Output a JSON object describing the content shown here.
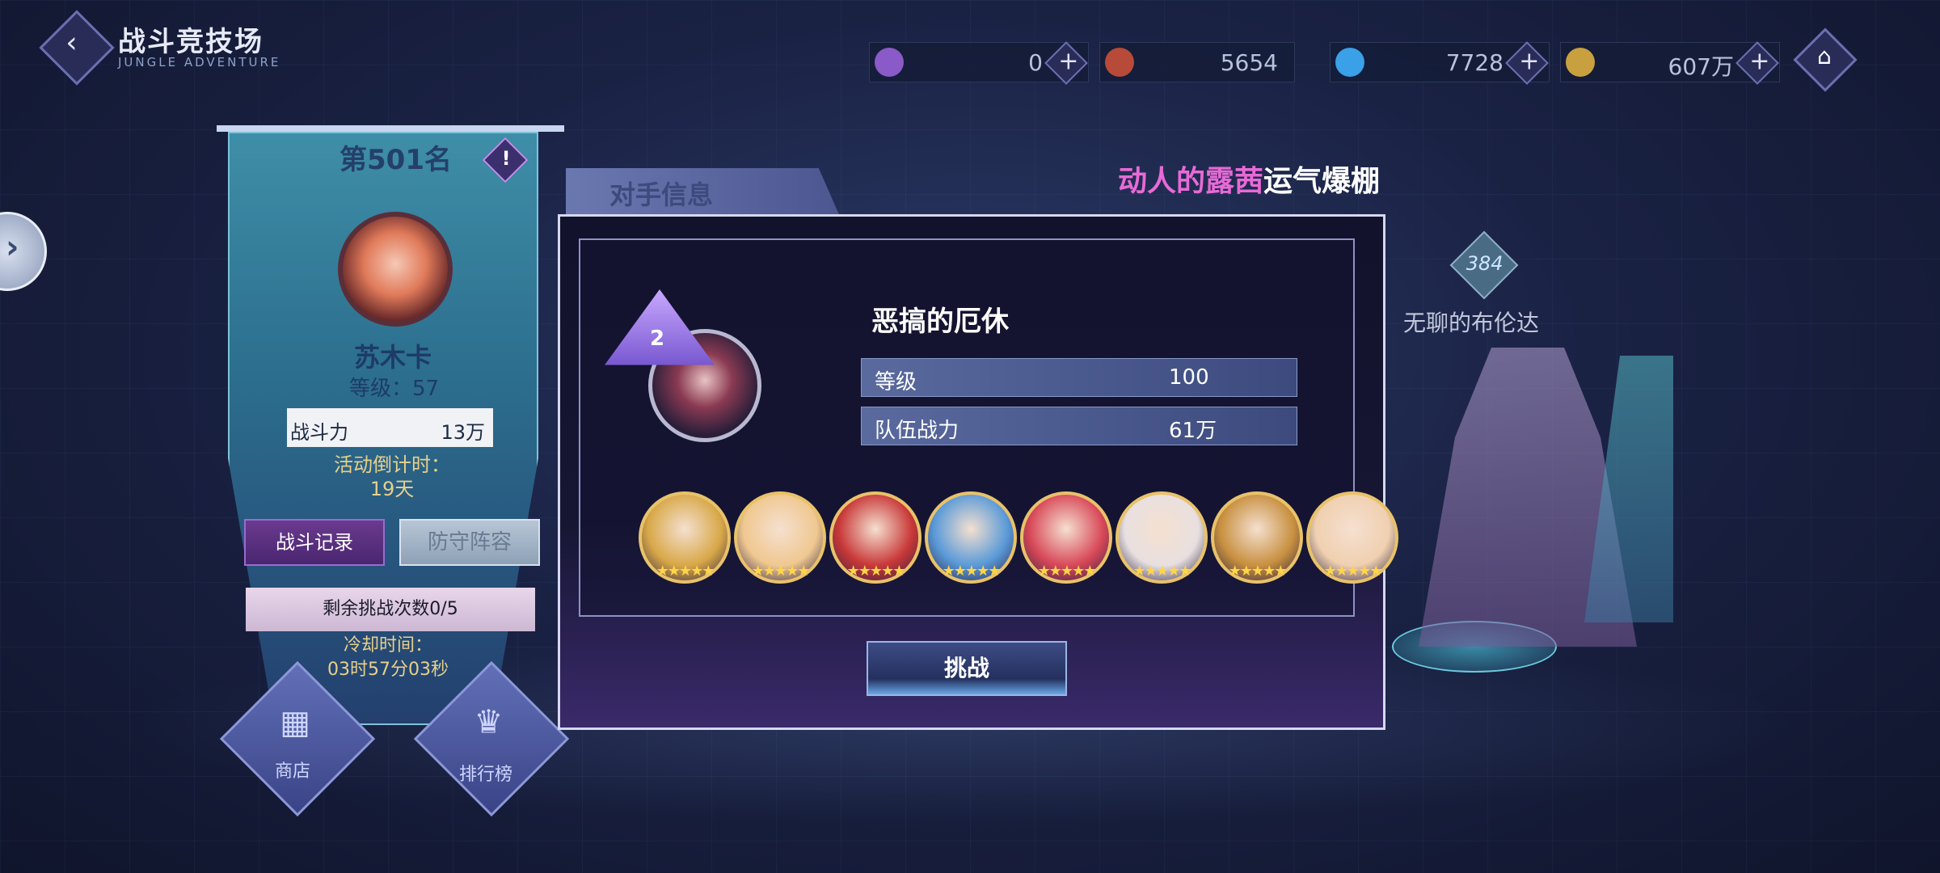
{
  "header": {
    "title": "战斗竞技场",
    "subtitle": "JUNGLE ADVENTURE",
    "back_glyph": "‹",
    "home_glyph": "⌂"
  },
  "resources": [
    {
      "icon": "purple-gem-icon",
      "value": "0",
      "color": "#8a5ac8"
    },
    {
      "icon": "medal-coin-icon",
      "value": "5654",
      "color": "#b84a3a"
    },
    {
      "icon": "blue-diamond-icon",
      "value": "7728",
      "color": "#3aa0e8"
    },
    {
      "icon": "gold-coin-icon",
      "value": "607万",
      "color": "#c8a040"
    }
  ],
  "player": {
    "rank": "第501名",
    "info_glyph": "!",
    "name": "苏木卡",
    "level": "等级：57",
    "power_label": "战斗力",
    "power_value": "13万",
    "countdown_label": "活动倒计时：",
    "countdown_value": "19天",
    "record_button": "战斗记录",
    "defense_button": "防守阵容",
    "remaining": "剩余挑战次数0/5",
    "cooldown_label": "冷却时间：",
    "cooldown_value": "03时57分03秒"
  },
  "bottom_buttons": {
    "shop_label": "商店",
    "rank_label": "排行榜"
  },
  "dialog": {
    "tab_label": "对手信息",
    "marquee_pink": "动人的露茜",
    "marquee_white": "运气爆棚",
    "rank_number": "2",
    "opponent_name": "恶搞的厄休",
    "level_label": "等级",
    "level_value": "100",
    "power_label": "队伍战力",
    "power_value": "61万",
    "heroes": [
      {
        "name": "hero-1",
        "color": "#d8a848",
        "stars": "★★★★★"
      },
      {
        "name": "hero-2",
        "color": "#f0c890",
        "stars": "★★★★★"
      },
      {
        "name": "hero-3",
        "color": "#c83838",
        "stars": "★★★★★"
      },
      {
        "name": "hero-4",
        "color": "#5a9ad8",
        "stars": "★★★★★"
      },
      {
        "name": "hero-5",
        "color": "#d84858",
        "stars": "★★★★★"
      },
      {
        "name": "hero-6",
        "color": "#e8e0e0",
        "stars": "★★★★★"
      },
      {
        "name": "hero-7",
        "color": "#c89040",
        "stars": "★★★★★"
      },
      {
        "name": "hero-8",
        "color": "#f0d0b0",
        "stars": "★★★★★"
      }
    ],
    "challenge_button": "挑战"
  },
  "right_opponent": {
    "number": "384",
    "name": "无聊的布伦达"
  }
}
